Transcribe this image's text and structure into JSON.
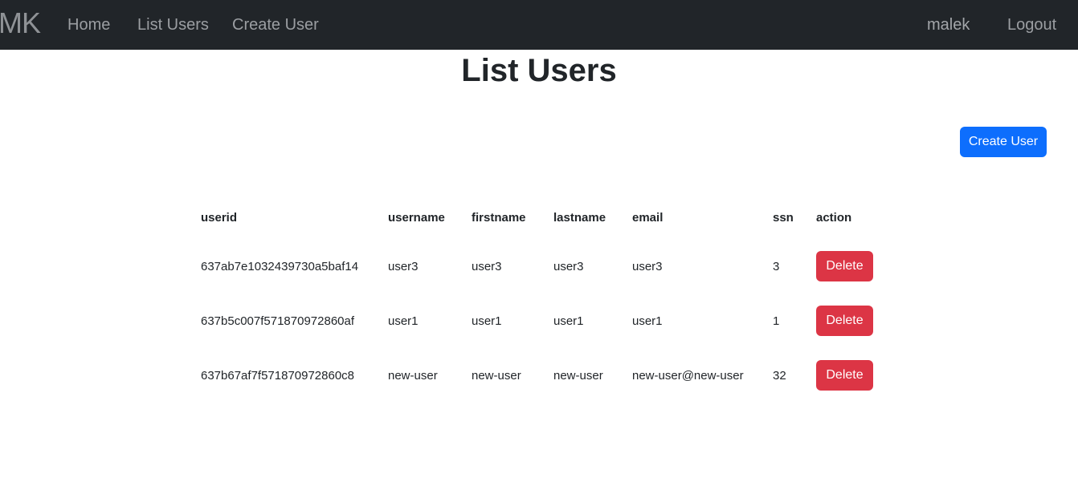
{
  "nav": {
    "brand": "MK",
    "links": [
      "Home",
      "List Users",
      "Create User"
    ],
    "username": "malek",
    "logout": "Logout"
  },
  "page": {
    "title": "List Users",
    "create_button": "Create User"
  },
  "table": {
    "columns": [
      "userid",
      "username",
      "firstname",
      "lastname",
      "email",
      "ssn",
      "action"
    ],
    "rows": [
      {
        "userid": "637ab7e1032439730a5baf14",
        "username": "user3",
        "firstname": "user3",
        "lastname": "user3",
        "email": "user3",
        "ssn": "3",
        "action": "Delete"
      },
      {
        "userid": "637b5c007f571870972860af",
        "username": "user1",
        "firstname": "user1",
        "lastname": "user1",
        "email": "user1",
        "ssn": "1",
        "action": "Delete"
      },
      {
        "userid": "637b67af7f571870972860c8",
        "username": "new-user",
        "firstname": "new-user",
        "lastname": "new-user",
        "email": "new-user@new-user",
        "ssn": "32",
        "action": "Delete"
      }
    ]
  },
  "colors": {
    "navbar": "#212529",
    "primary": "#0d6efd",
    "danger": "#dc3545"
  }
}
